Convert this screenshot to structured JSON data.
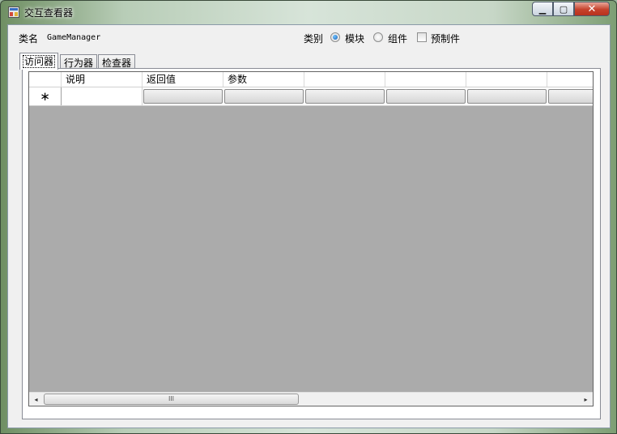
{
  "window": {
    "title": "交互查看器",
    "caption": {
      "minimize": "▁",
      "maximize": "▢",
      "close": "✕"
    }
  },
  "form": {
    "class_label": "类名",
    "class_value": "GameManager",
    "category_label": "类别",
    "radio_options": [
      {
        "label": "模块",
        "checked": true
      },
      {
        "label": "组件",
        "checked": false
      }
    ],
    "prefab_label": "预制件",
    "prefab_checked": false
  },
  "tabs": [
    {
      "label": "访问器",
      "active": true
    },
    {
      "label": "行为器",
      "active": false
    },
    {
      "label": "检查器",
      "active": false
    }
  ],
  "grid": {
    "columns": [
      "",
      "说明",
      "返回值",
      "参数",
      "",
      "",
      "",
      ""
    ],
    "new_row_marker": "∗",
    "rows": []
  },
  "scrollbar": {
    "left_arrow": "◂",
    "right_arrow": "▸",
    "thumb_grip": "III"
  },
  "colors": {
    "grid_background": "#ababab",
    "close_button": "#c6412b"
  }
}
